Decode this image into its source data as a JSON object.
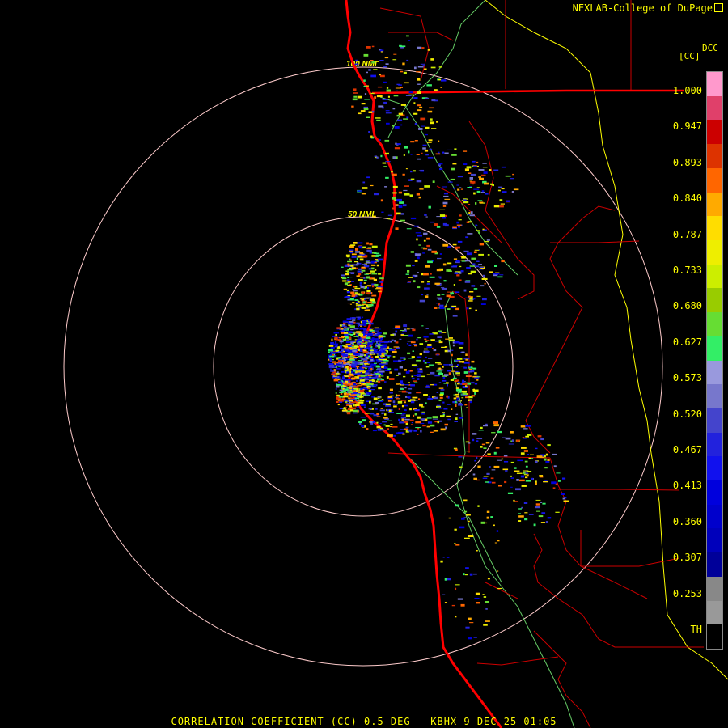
{
  "credit": "NEXLAB-College of DuPage",
  "product": "DCC",
  "unit": "[CC]",
  "footer": "CORRELATION COEFFICIENT (CC) 0.5 DEG - KBHX 9 DEC 25 01:05",
  "range_rings": [
    {
      "label": "50 NMI"
    },
    {
      "label": "100 NMI"
    }
  ],
  "colorbar": {
    "ticks": [
      "1.000",
      "0.947",
      "0.893",
      "0.840",
      "0.787",
      "0.733",
      "0.680",
      "0.627",
      "0.573",
      "0.520",
      "0.467",
      "0.413",
      "0.360",
      "0.307",
      "0.253",
      "TH"
    ],
    "colors_top_to_bottom": [
      "#ff99cc",
      "#e0406a",
      "#cc0000",
      "#dd3300",
      "#ff6600",
      "#ffaa00",
      "#ffdd00",
      "#eeee00",
      "#ccee00",
      "#99cc00",
      "#66dd33",
      "#33ee66",
      "#9999dd",
      "#7777cc",
      "#4444cc",
      "#2222dd",
      "#1111ee",
      "#0000dd",
      "#0000cc",
      "#0000bb",
      "#000099",
      "#888888",
      "#999999",
      "#000000"
    ]
  },
  "colors": {
    "ring": "#ffcccc",
    "coast": "#ff0000",
    "county": "#cc0000",
    "state": "#ffff00",
    "forecast_zone": "#66cc66",
    "text": "#ffff00"
  }
}
